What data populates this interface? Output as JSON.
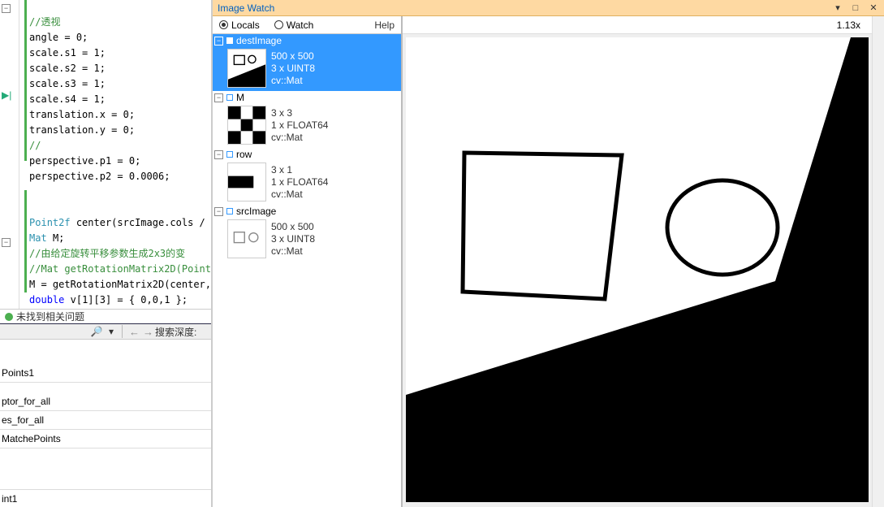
{
  "editor": {
    "comment1": "//透视",
    "l1": "angle = 0;",
    "l2": "scale.s1 = 1;",
    "l3": "scale.s2 = 1;",
    "l4": "scale.s3 = 1;",
    "l5": "scale.s4 = 1;",
    "l6": "translation.x = 0;",
    "l7": "translation.y = 0;",
    "l8": "//",
    "l9": "perspective.p1 = 0;",
    "l10": "perspective.p2 = 0.0006;",
    "blank": "",
    "l11_a": "Point2f",
    "l11_b": " center(srcImage.cols / ",
    "l12_a": "Mat",
    "l12_b": " M;",
    "l13": "//由给定旋转平移参数生成2x3的变",
    "l14": "//Mat getRotationMatrix2D(Point",
    "l15": "M = getRotationMatrix2D(center,",
    "l16_a": "double",
    "l16_b": " v[1][3] = { 0,0,1 };"
  },
  "status": {
    "text": "未找到相关问题"
  },
  "search": {
    "depth_label": "搜索深度:"
  },
  "bottom": {
    "header": "Points1",
    "r1": "ptor_for_all",
    "r2": "es_for_all",
    "r3": "MatchePoints",
    "footer": "int1"
  },
  "watch": {
    "title": "Image Watch",
    "locals": "Locals",
    "watch_tab": "Watch",
    "help": "Help",
    "zoom": "1.13x",
    "items": [
      {
        "name": "destImage",
        "dim": "500 x 500",
        "type": "3 x UINT8",
        "cls": "cv::Mat"
      },
      {
        "name": "M",
        "dim": "3 x 3",
        "type": "1 x FLOAT64",
        "cls": "cv::Mat"
      },
      {
        "name": "row",
        "dim": "3 x 1",
        "type": "1 x FLOAT64",
        "cls": "cv::Mat"
      },
      {
        "name": "srcImage",
        "dim": "500 x 500",
        "type": "3 x UINT8",
        "cls": "cv::Mat"
      }
    ]
  }
}
